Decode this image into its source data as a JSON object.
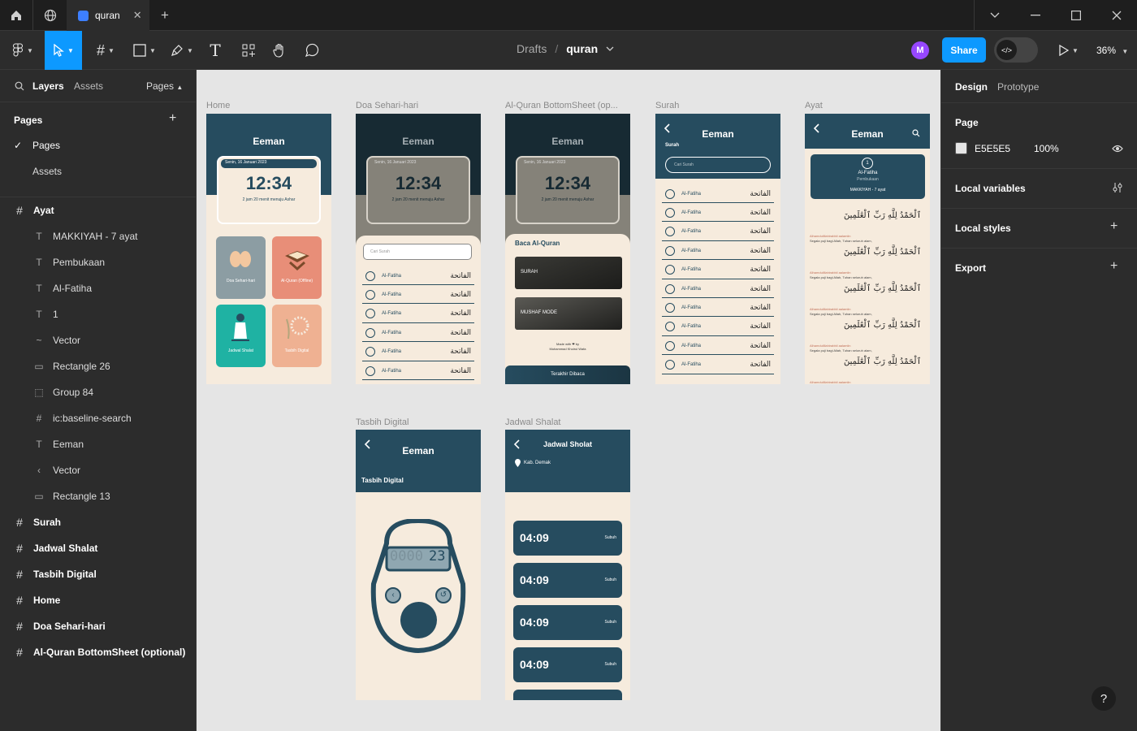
{
  "titlebar": {
    "tab_title": "quran",
    "tab_close": "✕",
    "new_tab": "+"
  },
  "toolbar": {
    "breadcrumb_parent": "Drafts",
    "breadcrumb_sep": "/",
    "file_name": "quran",
    "avatar_initial": "M",
    "share_label": "Share",
    "zoom": "36%"
  },
  "left_panel": {
    "tabs": [
      "Layers",
      "Assets"
    ],
    "pages_dropdown": "Pages",
    "pages_header": "Pages",
    "pages": [
      {
        "label": "Pages",
        "checked": true
      },
      {
        "label": "Assets",
        "checked": false
      }
    ],
    "layers": [
      {
        "label": "Ayat",
        "icon": "#",
        "level": 0
      },
      {
        "label": "MAKKIYAH - 7 ayat",
        "icon": "T",
        "level": 1
      },
      {
        "label": "Pembukaan",
        "icon": "T",
        "level": 1
      },
      {
        "label": "Al-Fatiha",
        "icon": "T",
        "level": 1
      },
      {
        "label": "1",
        "icon": "T",
        "level": 1
      },
      {
        "label": "Vector",
        "icon": "~",
        "level": 1
      },
      {
        "label": "Rectangle 26",
        "icon": "▭",
        "level": 1
      },
      {
        "label": "Group 84",
        "icon": "⬚",
        "level": 1
      },
      {
        "label": "ic:baseline-search",
        "icon": "#",
        "level": 1
      },
      {
        "label": "Eeman",
        "icon": "T",
        "level": 1
      },
      {
        "label": "Vector",
        "icon": "‹",
        "level": 1
      },
      {
        "label": "Rectangle 13",
        "icon": "▭",
        "level": 1
      },
      {
        "label": "Surah",
        "icon": "#",
        "level": 0
      },
      {
        "label": "Jadwal Shalat",
        "icon": "#",
        "level": 0
      },
      {
        "label": "Tasbih Digital",
        "icon": "#",
        "level": 0
      },
      {
        "label": "Home",
        "icon": "#",
        "level": 0
      },
      {
        "label": "Doa Sehari-hari",
        "icon": "#",
        "level": 0
      },
      {
        "label": "Al-Quran BottomSheet (optional)",
        "icon": "#",
        "level": 0
      }
    ]
  },
  "canvas": {
    "frame_labels": [
      "Home",
      "Doa Sehari-hari",
      "Al-Quran BottomSheet (op...",
      "Surah",
      "Ayat",
      "Tasbih Digital",
      "Jadwal Shalat"
    ],
    "app_name": "Eeman",
    "date": "Senin, 16 Januari 2023",
    "time": "12:34",
    "countdown": "2 jam 20 menit menuju Ashar",
    "home_cards": [
      "Doa Sehari-hari",
      "Al-Quran (Offline)",
      "Jadwal Shalat",
      "Tasbih Digital"
    ],
    "search_placeholder": "Cari Surah",
    "surah_name": "Al-Fatiha",
    "surah_arabic": "الفاتحة",
    "surah_label": "Surah",
    "bottomsheet_title": "Baca Al-Quran",
    "bottomsheet_options": [
      "SURAH",
      "MUSHAF MODE"
    ],
    "made_with": "Made with ❤ by",
    "author": "Muhammad Khoirul Wafa",
    "last_read": "Terakhir Dibaca",
    "ayat_title": "Al-Fatiha",
    "ayat_subtitle": "Pembukaan",
    "ayat_meta": "MAKKIYAH - 7 ayat",
    "ayah_arabic": "ٱلْحَمْدُ لِلَّهِ رَبِّ ٱلْعَٰلَمِينَ",
    "ayah_translit": "Alhamdulillahirabbil aalamiin",
    "ayah_translation": "Segala puji bagi Allah, Tuhan seluruh alam,",
    "tasbih_header": "Tasbih Digital",
    "tasbih_count": "23",
    "tasbih_dim": "0000",
    "jadwal_title": "Jadwal Sholat",
    "jadwal_location": "Kab. Demak",
    "prayer_time": "04:09",
    "prayer_name": "Subuh"
  },
  "right_panel": {
    "tabs": [
      "Design",
      "Prototype"
    ],
    "page_section": "Page",
    "page_color": "E5E5E5",
    "page_opacity": "100%",
    "sections": [
      "Local variables",
      "Local styles",
      "Export"
    ]
  },
  "colors": {
    "accent": "#0d99ff",
    "teal": "#264c5f",
    "cream": "#f6ebdd",
    "canvas_bg": "#e5e5e5"
  }
}
